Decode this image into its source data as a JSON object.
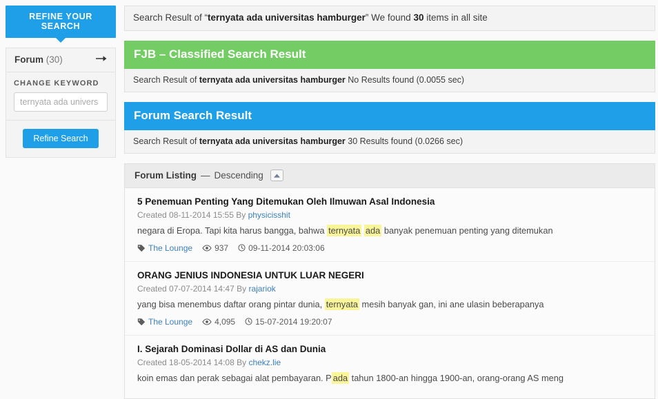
{
  "sidebar": {
    "refine_tab_label": "REFINE YOUR SEARCH",
    "forum_label": "Forum",
    "forum_count": "(30)",
    "arrow_icon": "arrow-right-icon",
    "change_keyword_label": "CHANGE KEYWORD",
    "keyword_value": "",
    "keyword_placeholder": "ternyata ada univers",
    "refine_button_label": "Refine Search"
  },
  "topbar": {
    "prefix": "Search Result of “",
    "query": "ternyata ada universitas hamburger",
    "suffix": "” We found ",
    "count": "30",
    "tail": " items in all site"
  },
  "sections": [
    {
      "id": "fjb",
      "title": "FJB – Classified Search Result",
      "color": "#74cd64",
      "sub_prefix": "Search Result of ",
      "sub_query": "ternyata ada universitas hamburger",
      "sub_suffix": " No Results found (0.0055 sec)"
    },
    {
      "id": "forum",
      "title": "Forum Search Result",
      "color": "#1e9fe8",
      "sub_prefix": "Search Result of ",
      "sub_query": "ternyata ada universitas hamburger",
      "sub_suffix": " 30 Results found (0.0266 sec)"
    }
  ],
  "listing": {
    "heading": "Forum Listing",
    "separator": "—",
    "sort_order": "Descending",
    "sort_toggle_icon": "caret-up-icon",
    "results": [
      {
        "title": "5 Penemuan Penting Yang Ditemukan Oleh Ilmuwan Asal Indonesia",
        "created_prefix": "Created 08-11-2014 15:55 By ",
        "author": "physicisshit",
        "snippet_before": "negara di Eropa. Tapi kita harus bangga, bahwa ",
        "highlight_1": "ternyata",
        "snippet_mid": " ",
        "highlight_2": "ada",
        "snippet_after": " banyak penemuan penting yang ditemukan",
        "tag_icon": "tag-icon",
        "tag": "The Lounge",
        "views_icon": "eye-icon",
        "views": "937",
        "time_icon": "clock-icon",
        "time": "09-11-2014 20:03:06"
      },
      {
        "title": "ORANG JENIUS INDONESIA UNTUK LUAR NEGERI",
        "created_prefix": "Created 07-07-2014 14:47 By ",
        "author": "rajariok",
        "snippet_before": "yang bisa menembus daftar orang pintar dunia, ",
        "highlight_1": "ternyata",
        "snippet_mid": "",
        "highlight_2": "",
        "snippet_after": " mesih banyak gan, ini ane ulasin beberapanya",
        "tag_icon": "tag-icon",
        "tag": "The Lounge",
        "views_icon": "eye-icon",
        "views": "4,095",
        "time_icon": "clock-icon",
        "time": "15-07-2014 19:20:07"
      },
      {
        "title": "I. Sejarah Dominasi Dollar di AS dan Dunia",
        "created_prefix": "Created 18-05-2014 14:08 By ",
        "author": "chekz.lie",
        "snippet_before": "koin emas dan perak sebagai alat pembayaran. P",
        "highlight_1": "ada",
        "snippet_mid": "",
        "highlight_2": "",
        "snippet_after": " tahun 1800-an hingga 1900-an, orang-orang AS meng",
        "tag_icon": "tag-icon",
        "tag": "",
        "views_icon": "eye-icon",
        "views": "",
        "time_icon": "clock-icon",
        "time": ""
      }
    ]
  },
  "colors": {
    "accent_blue": "#1e9fe8",
    "accent_green": "#74cd64",
    "link_blue": "#3b7fbf",
    "highlight_yellow": "#fbf59a"
  }
}
